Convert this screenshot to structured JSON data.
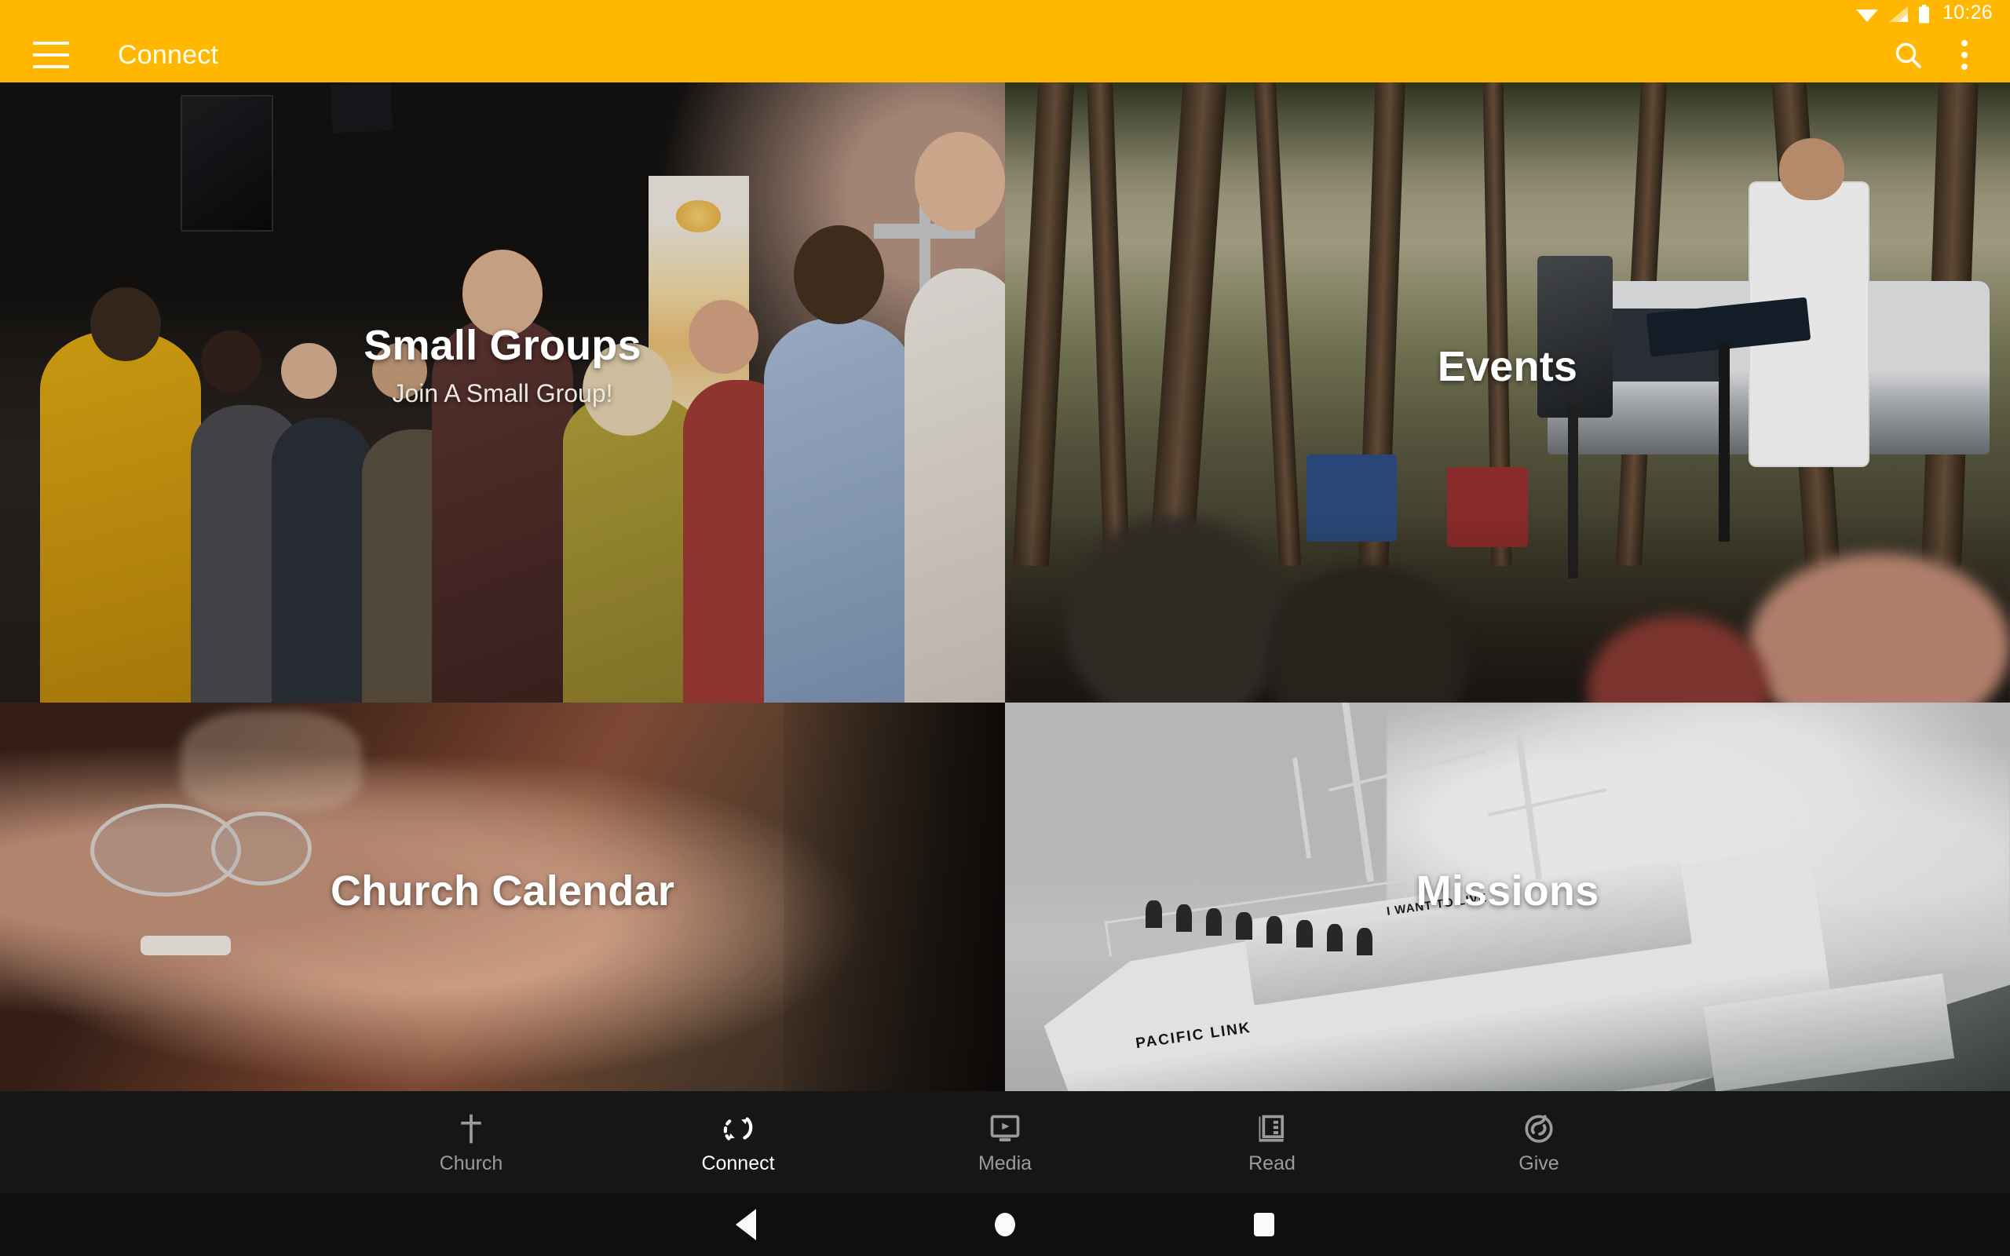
{
  "theme": {
    "brand_color": "#FFB700",
    "appbar_text_color": "#FFFDF3",
    "nav_background": "#141617",
    "nav_active_color": "#FFFFFF",
    "nav_inactive_color": "#9B9B9B",
    "card_title_color": "#FFFFFF"
  },
  "status_bar": {
    "time": "10:26",
    "icons": [
      "wifi-icon",
      "cellular-signal-icon",
      "battery-icon"
    ]
  },
  "app_bar": {
    "menu_icon": "hamburger-menu-icon",
    "title": "Connect",
    "search_icon": "search-icon",
    "overflow_icon": "overflow-menu-icon"
  },
  "cards": [
    {
      "title": "Small Groups",
      "subtitle": "Join A Small Group!",
      "image": "small-groups-photo"
    },
    {
      "title": "Events",
      "subtitle": "",
      "image": "events-photo"
    },
    {
      "title": "Church Calendar",
      "subtitle": "",
      "image": "church-calendar-photo"
    },
    {
      "title": "Missions",
      "subtitle": "",
      "image": "missions-photo"
    }
  ],
  "missions_photo_text": {
    "ship_name": "PACIFIC LINK",
    "banner": "I WANT TO LIVE"
  },
  "bottom_nav": {
    "items": [
      {
        "label": "Church",
        "icon": "cross-icon",
        "active": false
      },
      {
        "label": "Connect",
        "icon": "sync-arrows-icon",
        "active": true
      },
      {
        "label": "Media",
        "icon": "monitor-play-icon",
        "active": false
      },
      {
        "label": "Read",
        "icon": "book-icon",
        "active": false
      },
      {
        "label": "Give",
        "icon": "giving-circle-icon",
        "active": false
      }
    ]
  },
  "system_nav": {
    "back_label": "Back",
    "home_label": "Home",
    "recents_label": "Recent apps"
  }
}
